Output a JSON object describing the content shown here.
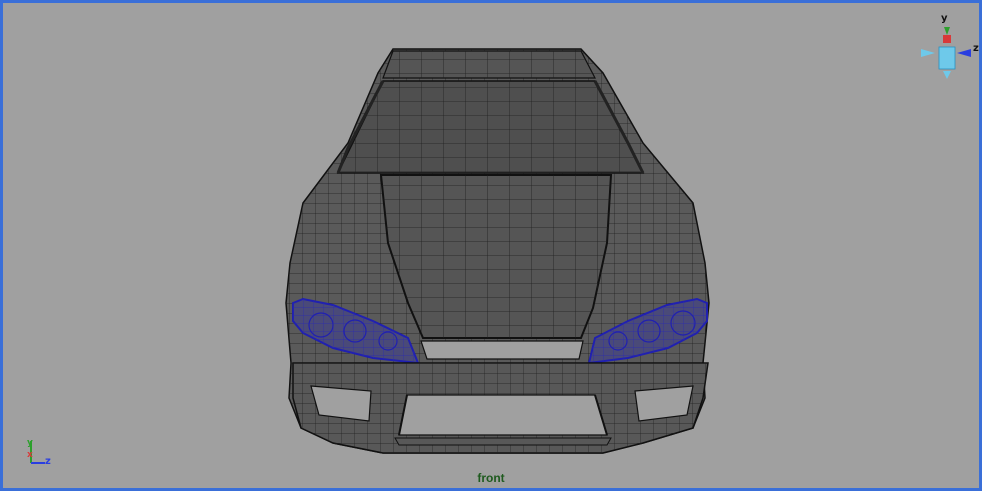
{
  "viewport": {
    "camera_label": "front",
    "active_border_color": "#3a6fd8",
    "background_color": "#a0a0a0"
  },
  "view_cube": {
    "icon": "view-cube-icon",
    "y_label": "y",
    "z_label": "z"
  },
  "axis_gizmo": {
    "icon": "axis-gizmo-icon",
    "y_label": "y",
    "x_label": "x",
    "z_label": "z"
  },
  "model": {
    "icon": "car-wireframe-icon",
    "mesh_color": "#5a5a5a",
    "wire_color": "#1a1a1a",
    "selected_color": "#2a2ab0"
  }
}
